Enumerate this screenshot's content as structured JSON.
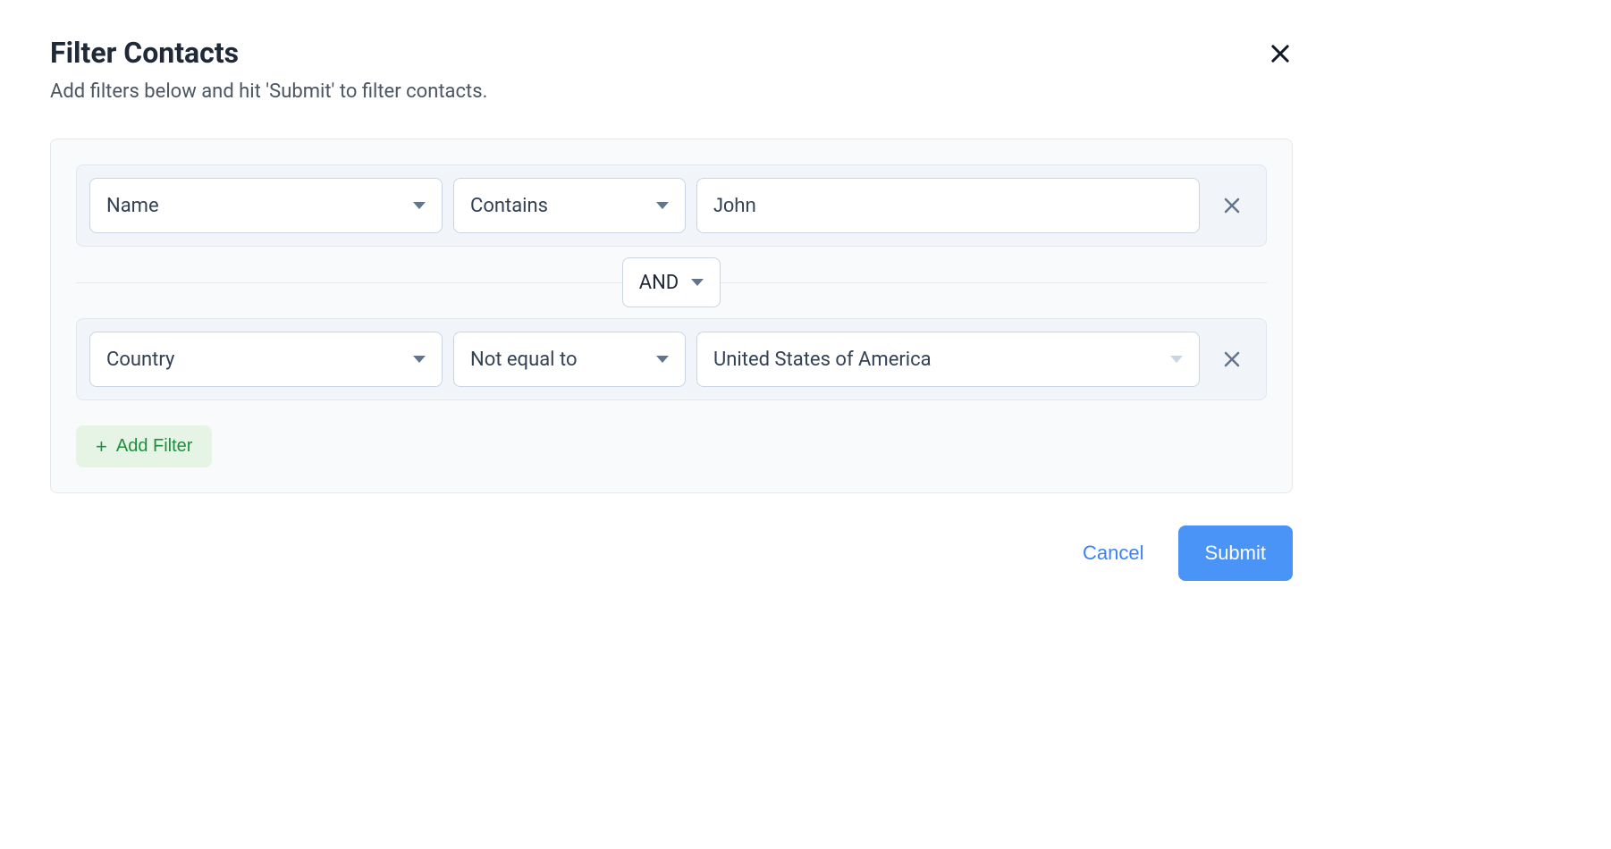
{
  "modal": {
    "title": "Filter Contacts",
    "subtitle": "Add filters below and hit 'Submit' to filter contacts."
  },
  "filters": {
    "rows": [
      {
        "field": "Name",
        "operator": "Contains",
        "value": "John",
        "value_type": "text"
      },
      {
        "field": "Country",
        "operator": "Not equal to",
        "value": "United States of America",
        "value_type": "select"
      }
    ],
    "logic": "AND",
    "add_label": "Add Filter"
  },
  "footer": {
    "cancel": "Cancel",
    "submit": "Submit"
  }
}
